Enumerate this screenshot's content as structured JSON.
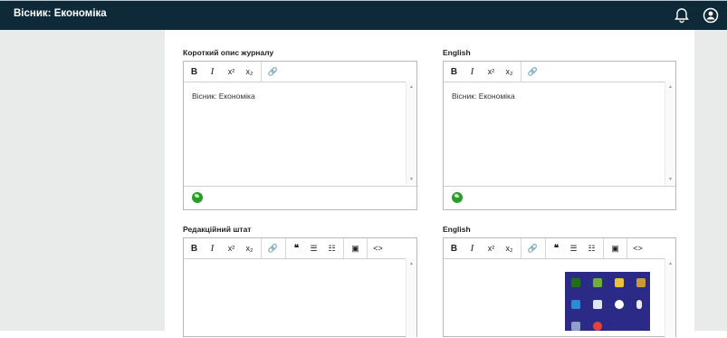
{
  "header": {
    "title": "Вісник: Економіка",
    "icons": [
      "bell-icon",
      "user-circle-icon"
    ]
  },
  "sections": [
    {
      "label": "Короткий опис журналу",
      "content": "Вісник: Економіка"
    },
    {
      "label": "English",
      "content": "Вісник: Економіка"
    },
    {
      "label": "Редакційний штат",
      "content": ""
    },
    {
      "label": "English",
      "content": ""
    }
  ],
  "toolbar_basic": [
    "B",
    "I",
    "x²",
    "x₂",
    "🔗"
  ],
  "toolbar_extended": [
    "B",
    "I",
    "x²",
    "x₂",
    "🔗",
    "❝",
    "☰",
    "☷",
    "▣",
    "<>"
  ],
  "colors": {
    "header_bg": "#0e2938",
    "sidebar_bg": "#e9eaea",
    "globe": "#2a9c2a",
    "tray_bg": "#2b2b87"
  }
}
